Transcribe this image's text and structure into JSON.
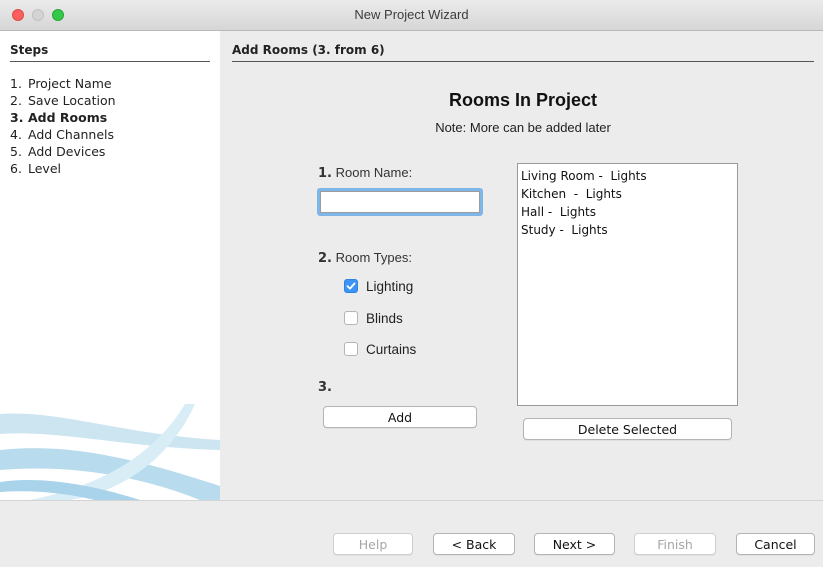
{
  "window": {
    "title": "New Project Wizard"
  },
  "steps": {
    "heading": "Steps",
    "items": [
      {
        "num": "1.",
        "label": "Project Name",
        "current": false
      },
      {
        "num": "2.",
        "label": "Save Location",
        "current": false
      },
      {
        "num": "3.",
        "label": "Add Rooms",
        "current": true
      },
      {
        "num": "4.",
        "label": "Add Channels",
        "current": false
      },
      {
        "num": "5.",
        "label": "Add Devices",
        "current": false
      },
      {
        "num": "6.",
        "label": "Level",
        "current": false
      }
    ]
  },
  "content": {
    "heading": "Add Rooms (3. from 6)",
    "title": "Rooms In Project",
    "note": "Note: More can be added later",
    "room_name": {
      "num": "1.",
      "label": "Room Name:",
      "value": ""
    },
    "room_types": {
      "num": "2.",
      "label": "Room Types:",
      "options": [
        {
          "label": "Lighting",
          "checked": true
        },
        {
          "label": "Blinds",
          "checked": false
        },
        {
          "label": "Curtains",
          "checked": false
        }
      ]
    },
    "step3_num": "3.",
    "add_label": "Add",
    "rooms": [
      "Living Room -  Lights",
      "Kitchen  -  Lights",
      "Hall -  Lights",
      "Study -  Lights"
    ],
    "delete_label": "Delete Selected"
  },
  "footer": {
    "help": "Help",
    "back": "< Back",
    "next": "Next >",
    "finish": "Finish",
    "cancel": "Cancel"
  },
  "colors": {
    "checkbox_checked": "#3b95f6",
    "focus_ring": "#7fb6e8",
    "close": "#fc605c",
    "maximize": "#34c84a"
  },
  "icons": {
    "checkmark": "check-icon"
  }
}
